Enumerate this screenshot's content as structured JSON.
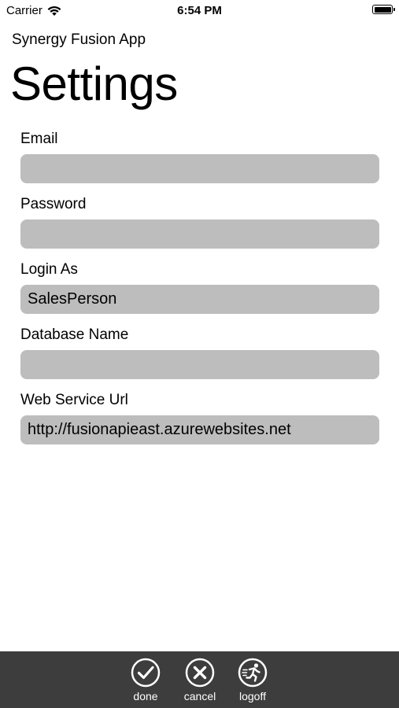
{
  "status_bar": {
    "carrier": "Carrier",
    "time": "6:54 PM"
  },
  "app": {
    "name": "Synergy Fusion App",
    "title": "Settings"
  },
  "form": {
    "fields": [
      {
        "label": "Email",
        "value": ""
      },
      {
        "label": "Password",
        "value": ""
      },
      {
        "label": "Login As",
        "value": "SalesPerson"
      },
      {
        "label": "Database Name",
        "value": ""
      },
      {
        "label": "Web Service Url",
        "value": "http://fusionapieast.azurewebsites.net"
      }
    ]
  },
  "toolbar": {
    "items": [
      {
        "label": "done",
        "icon": "checkmark-circle-icon"
      },
      {
        "label": "cancel",
        "icon": "x-circle-icon"
      },
      {
        "label": "logoff",
        "icon": "running-person-icon"
      }
    ]
  },
  "colors": {
    "input_background": "#bdbdbd",
    "toolbar_background": "#3d3d3d"
  }
}
